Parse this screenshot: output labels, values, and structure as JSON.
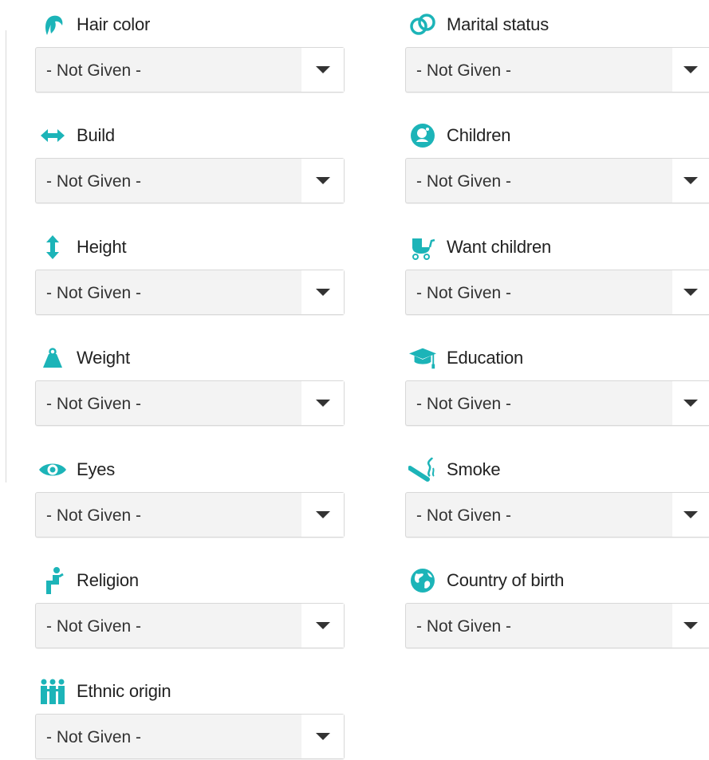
{
  "accent_color": "#1cb4b8",
  "fields": [
    {
      "id": "hair-color",
      "label": "Hair color",
      "value": "- Not Given -",
      "icon": "hair-icon"
    },
    {
      "id": "marital-status",
      "label": "Marital status",
      "value": "- Not Given -",
      "icon": "rings-icon"
    },
    {
      "id": "build",
      "label": "Build",
      "value": "- Not Given -",
      "icon": "horizontal-arrows-icon"
    },
    {
      "id": "children",
      "label": "Children",
      "value": "- Not Given -",
      "icon": "baby-icon"
    },
    {
      "id": "height",
      "label": "Height",
      "value": "- Not Given -",
      "icon": "vertical-arrows-icon"
    },
    {
      "id": "want-children",
      "label": "Want children",
      "value": "- Not Given -",
      "icon": "stroller-icon"
    },
    {
      "id": "weight",
      "label": "Weight",
      "value": "- Not Given -",
      "icon": "weight-icon"
    },
    {
      "id": "education",
      "label": "Education",
      "value": "- Not Given -",
      "icon": "graduation-cap-icon"
    },
    {
      "id": "eyes",
      "label": "Eyes",
      "value": "- Not Given -",
      "icon": "eye-icon"
    },
    {
      "id": "smoke",
      "label": "Smoke",
      "value": "- Not Given -",
      "icon": "cigarette-icon"
    },
    {
      "id": "religion",
      "label": "Religion",
      "value": "- Not Given -",
      "icon": "kneeling-person-icon"
    },
    {
      "id": "country-of-birth",
      "label": "Country of birth",
      "value": "- Not Given -",
      "icon": "globe-icon"
    },
    {
      "id": "ethnic-origin",
      "label": "Ethnic origin",
      "value": "- Not Given -",
      "icon": "people-icon"
    }
  ]
}
